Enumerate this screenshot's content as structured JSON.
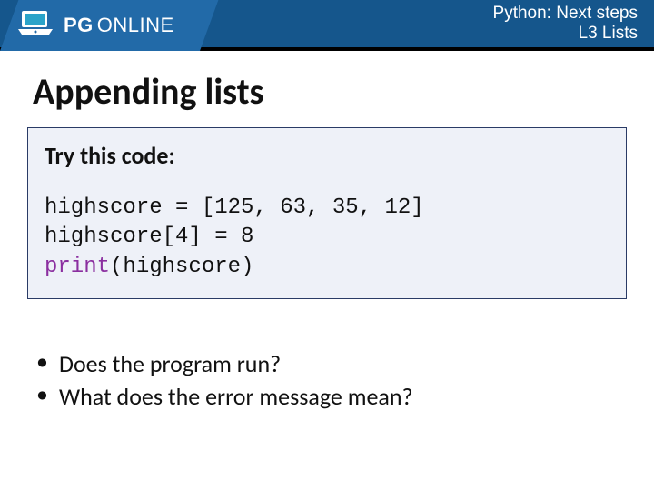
{
  "header": {
    "brand_bold": "PG",
    "brand_light": "ONLINE",
    "line1": "Python: Next steps",
    "line2": "L3 Lists"
  },
  "slide": {
    "title": "Appending lists",
    "panel_title": "Try this code:",
    "code": {
      "line1": "highscore = [125, 63, 35, 12]",
      "line2": "highscore[4] = 8",
      "line3_kw": "print",
      "line3_rest": "(highscore)"
    },
    "bullets": [
      "Does the program run?",
      "What does the error message mean?"
    ]
  }
}
